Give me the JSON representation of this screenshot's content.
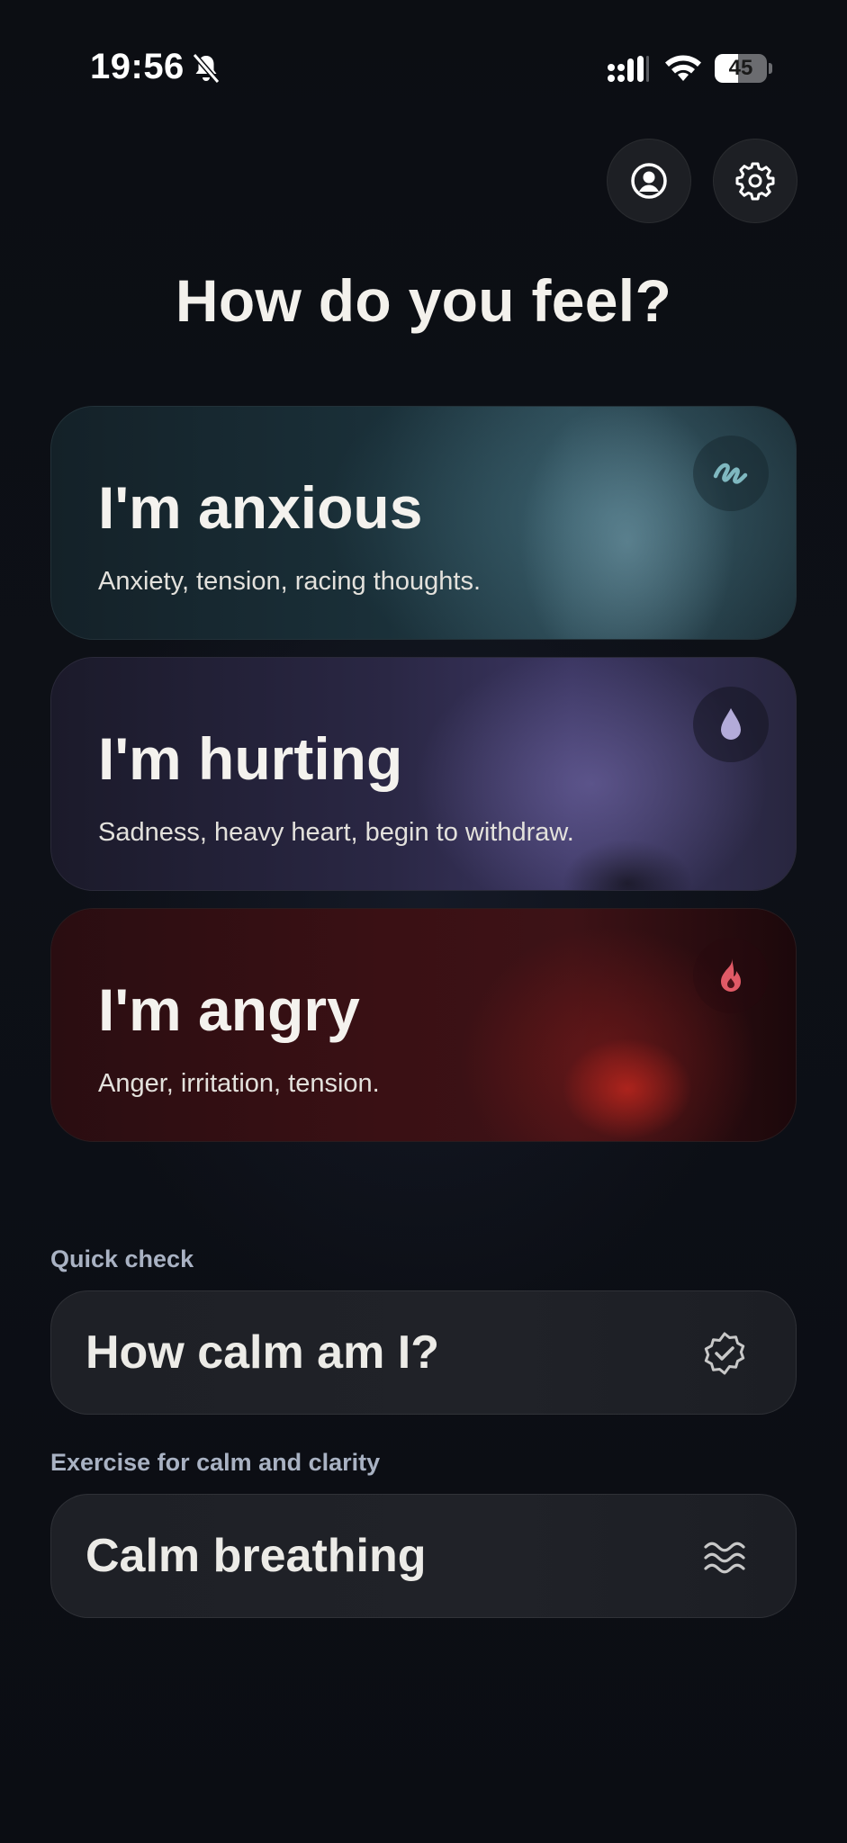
{
  "status_bar": {
    "time": "19:56",
    "battery_level": "45",
    "battery_fraction": 0.45
  },
  "header": {
    "profile_icon": "profile-icon",
    "settings_icon": "gear-icon",
    "title": "How do you feel?"
  },
  "emotions": [
    {
      "title": "I'm anxious",
      "subtitle": "Anxiety, tension, racing thoughts.",
      "icon": "squiggle-icon",
      "accent": "#7fb8c0"
    },
    {
      "title": "I'm hurting",
      "subtitle": "Sadness, heavy heart, begin to withdraw.",
      "icon": "drop-icon",
      "accent": "#b3abd9"
    },
    {
      "title": "I'm angry",
      "subtitle": "Anger, irritation, tension.",
      "icon": "flame-icon",
      "accent": "#e05a66"
    }
  ],
  "quick_check": {
    "label": "Quick check",
    "title": "How calm am I?",
    "icon": "verified-badge-icon"
  },
  "exercise": {
    "label": "Exercise for calm and clarity",
    "title": "Calm breathing",
    "icon": "waves-icon"
  }
}
